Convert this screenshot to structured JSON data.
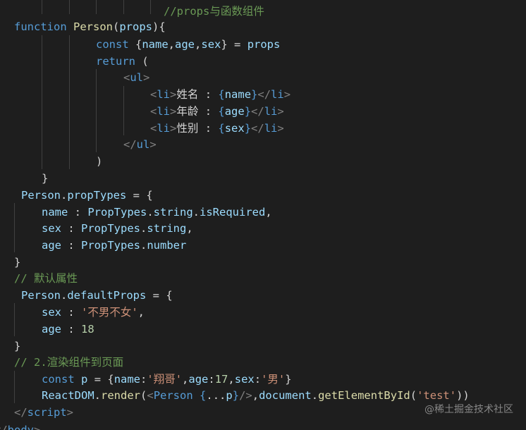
{
  "code_editor": {
    "lines": [
      {
        "tokens": [
          {
            "t": "//props与函数组件",
            "c": "comment"
          }
        ]
      },
      {
        "tokens": [
          {
            "t": "function",
            "c": "keyword"
          },
          {
            "t": " ",
            "c": "plain"
          },
          {
            "t": "Person",
            "c": "func"
          },
          {
            "t": "(",
            "c": "plain"
          },
          {
            "t": "props",
            "c": "ident"
          },
          {
            "t": "){",
            "c": "plain"
          }
        ]
      },
      {
        "tokens": [
          {
            "t": "const",
            "c": "keyword"
          },
          {
            "t": " {",
            "c": "plain"
          },
          {
            "t": "name",
            "c": "ident"
          },
          {
            "t": ",",
            "c": "plain"
          },
          {
            "t": "age",
            "c": "ident"
          },
          {
            "t": ",",
            "c": "plain"
          },
          {
            "t": "sex",
            "c": "ident"
          },
          {
            "t": "} = ",
            "c": "plain"
          },
          {
            "t": "props",
            "c": "ident"
          }
        ]
      },
      {
        "tokens": [
          {
            "t": "return",
            "c": "keyword"
          },
          {
            "t": " (",
            "c": "plain"
          }
        ]
      },
      {
        "tokens": [
          {
            "t": "<",
            "c": "bracket"
          },
          {
            "t": "ul",
            "c": "tag"
          },
          {
            "t": ">",
            "c": "bracket"
          }
        ]
      },
      {
        "tokens": [
          {
            "t": "<",
            "c": "bracket"
          },
          {
            "t": "li",
            "c": "tag"
          },
          {
            "t": ">",
            "c": "bracket"
          },
          {
            "t": "姓名 : ",
            "c": "plain"
          },
          {
            "t": "{",
            "c": "brace"
          },
          {
            "t": "name",
            "c": "ident"
          },
          {
            "t": "}",
            "c": "brace"
          },
          {
            "t": "</",
            "c": "bracket"
          },
          {
            "t": "li",
            "c": "tag"
          },
          {
            "t": ">",
            "c": "bracket"
          }
        ]
      },
      {
        "tokens": [
          {
            "t": "<",
            "c": "bracket"
          },
          {
            "t": "li",
            "c": "tag"
          },
          {
            "t": ">",
            "c": "bracket"
          },
          {
            "t": "年龄 : ",
            "c": "plain"
          },
          {
            "t": "{",
            "c": "brace"
          },
          {
            "t": "age",
            "c": "ident"
          },
          {
            "t": "}",
            "c": "brace"
          },
          {
            "t": "</",
            "c": "bracket"
          },
          {
            "t": "li",
            "c": "tag"
          },
          {
            "t": ">",
            "c": "bracket"
          }
        ]
      },
      {
        "tokens": [
          {
            "t": "<",
            "c": "bracket"
          },
          {
            "t": "li",
            "c": "tag"
          },
          {
            "t": ">",
            "c": "bracket"
          },
          {
            "t": "性别 : ",
            "c": "plain"
          },
          {
            "t": "{",
            "c": "brace"
          },
          {
            "t": "sex",
            "c": "ident"
          },
          {
            "t": "}",
            "c": "brace"
          },
          {
            "t": "</",
            "c": "bracket"
          },
          {
            "t": "li",
            "c": "tag"
          },
          {
            "t": ">",
            "c": "bracket"
          }
        ]
      },
      {
        "tokens": [
          {
            "t": "</",
            "c": "bracket"
          },
          {
            "t": "ul",
            "c": "tag"
          },
          {
            "t": ">",
            "c": "bracket"
          }
        ]
      },
      {
        "tokens": [
          {
            "t": ")",
            "c": "plain"
          }
        ]
      },
      {
        "tokens": [
          {
            "t": "}",
            "c": "plain"
          }
        ]
      },
      {
        "tokens": [
          {
            "t": "Person",
            "c": "ident"
          },
          {
            "t": ".",
            "c": "plain"
          },
          {
            "t": "propTypes",
            "c": "ident"
          },
          {
            "t": " = {",
            "c": "plain"
          }
        ]
      },
      {
        "tokens": [
          {
            "t": "name",
            "c": "ident"
          },
          {
            "t": " : ",
            "c": "plain"
          },
          {
            "t": "PropTypes",
            "c": "ident"
          },
          {
            "t": ".",
            "c": "plain"
          },
          {
            "t": "string",
            "c": "ident"
          },
          {
            "t": ".",
            "c": "plain"
          },
          {
            "t": "isRequired",
            "c": "ident"
          },
          {
            "t": ",",
            "c": "plain"
          }
        ]
      },
      {
        "tokens": [
          {
            "t": "sex",
            "c": "ident"
          },
          {
            "t": " : ",
            "c": "plain"
          },
          {
            "t": "PropTypes",
            "c": "ident"
          },
          {
            "t": ".",
            "c": "plain"
          },
          {
            "t": "string",
            "c": "ident"
          },
          {
            "t": ",",
            "c": "plain"
          }
        ]
      },
      {
        "tokens": [
          {
            "t": "age",
            "c": "ident"
          },
          {
            "t": " : ",
            "c": "plain"
          },
          {
            "t": "PropTypes",
            "c": "ident"
          },
          {
            "t": ".",
            "c": "plain"
          },
          {
            "t": "number",
            "c": "ident"
          }
        ]
      },
      {
        "tokens": [
          {
            "t": "}",
            "c": "plain"
          }
        ]
      },
      {
        "tokens": [
          {
            "t": "// 默认属性",
            "c": "comment"
          }
        ]
      },
      {
        "tokens": [
          {
            "t": "Person",
            "c": "ident"
          },
          {
            "t": ".",
            "c": "plain"
          },
          {
            "t": "defaultProps",
            "c": "ident"
          },
          {
            "t": " = {",
            "c": "plain"
          }
        ]
      },
      {
        "tokens": [
          {
            "t": "sex",
            "c": "ident"
          },
          {
            "t": " : ",
            "c": "plain"
          },
          {
            "t": "'不男不女'",
            "c": "string"
          },
          {
            "t": ",",
            "c": "plain"
          }
        ]
      },
      {
        "tokens": [
          {
            "t": "age",
            "c": "ident"
          },
          {
            "t": " : ",
            "c": "plain"
          },
          {
            "t": "18",
            "c": "number"
          }
        ]
      },
      {
        "tokens": [
          {
            "t": "}",
            "c": "plain"
          }
        ]
      },
      {
        "tokens": [
          {
            "t": "// 2.渲染组件到页面",
            "c": "comment"
          }
        ]
      },
      {
        "tokens": [
          {
            "t": "const",
            "c": "keyword"
          },
          {
            "t": " ",
            "c": "plain"
          },
          {
            "t": "p",
            "c": "ident"
          },
          {
            "t": " = {",
            "c": "plain"
          },
          {
            "t": "name",
            "c": "ident"
          },
          {
            "t": ":",
            "c": "plain"
          },
          {
            "t": "'翔哥'",
            "c": "string"
          },
          {
            "t": ",",
            "c": "plain"
          },
          {
            "t": "age",
            "c": "ident"
          },
          {
            "t": ":",
            "c": "plain"
          },
          {
            "t": "17",
            "c": "number"
          },
          {
            "t": ",",
            "c": "plain"
          },
          {
            "t": "sex",
            "c": "ident"
          },
          {
            "t": ":",
            "c": "plain"
          },
          {
            "t": "'男'",
            "c": "string"
          },
          {
            "t": "}",
            "c": "plain"
          }
        ]
      },
      {
        "tokens": [
          {
            "t": "ReactDOM",
            "c": "ident"
          },
          {
            "t": ".",
            "c": "plain"
          },
          {
            "t": "render",
            "c": "func"
          },
          {
            "t": "(",
            "c": "plain"
          },
          {
            "t": "<",
            "c": "bracket"
          },
          {
            "t": "Person",
            "c": "tag"
          },
          {
            "t": " ",
            "c": "plain"
          },
          {
            "t": "{",
            "c": "brace"
          },
          {
            "t": "...",
            "c": "plain"
          },
          {
            "t": "p",
            "c": "ident"
          },
          {
            "t": "}",
            "c": "brace"
          },
          {
            "t": "/>",
            "c": "bracket"
          },
          {
            "t": ",",
            "c": "plain"
          },
          {
            "t": "document",
            "c": "ident"
          },
          {
            "t": ".",
            "c": "plain"
          },
          {
            "t": "getElementById",
            "c": "func"
          },
          {
            "t": "(",
            "c": "plain"
          },
          {
            "t": "'test'",
            "c": "string"
          },
          {
            "t": "))",
            "c": "plain"
          }
        ]
      },
      {
        "tokens": [
          {
            "t": "</",
            "c": "bracket"
          },
          {
            "t": "script",
            "c": "tag"
          },
          {
            "t": ">",
            "c": "bracket"
          }
        ]
      },
      {
        "tokens": [
          {
            "t": "</",
            "c": "bracket"
          },
          {
            "t": "body",
            "c": "tag"
          },
          {
            "t": ">",
            "c": "bracket"
          }
        ]
      }
    ]
  },
  "watermark": {
    "text": "@稀土掘金技术社区"
  }
}
